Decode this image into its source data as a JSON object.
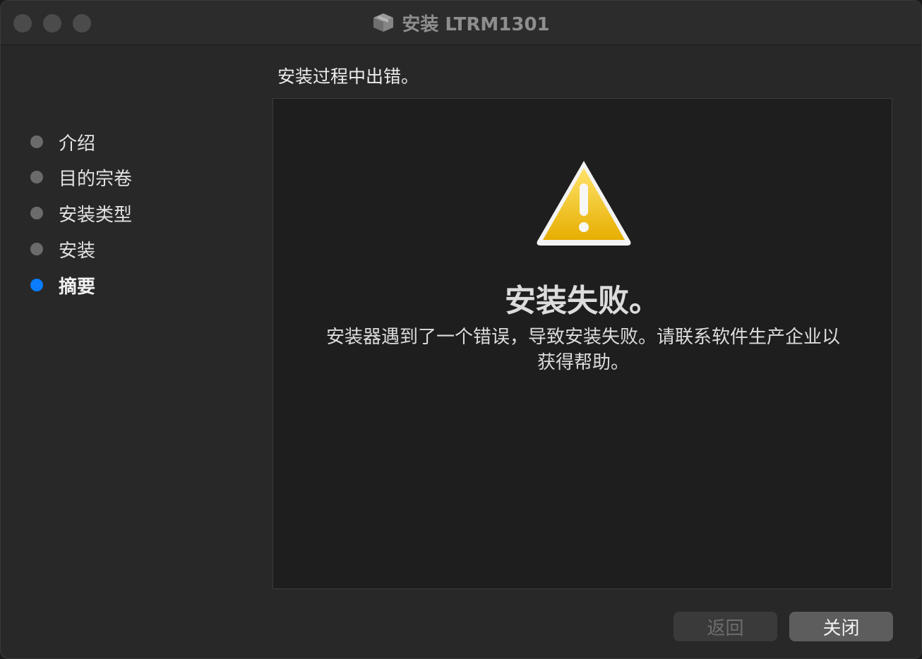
{
  "window": {
    "title": "安装 LTRM1301",
    "title_icon": "package-icon"
  },
  "sidebar": {
    "steps": [
      {
        "label": "介绍",
        "active": false
      },
      {
        "label": "目的宗卷",
        "active": false
      },
      {
        "label": "安装类型",
        "active": false
      },
      {
        "label": "安装",
        "active": false
      },
      {
        "label": "摘要",
        "active": true
      }
    ]
  },
  "main": {
    "heading": "安装过程中出错。",
    "icon": "warning-icon",
    "fail_title": "安装失败。",
    "fail_message": "安装器遇到了一个错误，导致安装失败。请联系软件生产企业以获得帮助。"
  },
  "buttons": {
    "back_label": "返回",
    "close_label": "关闭"
  },
  "colors": {
    "active_step": "#0a7cff",
    "warning_yellow": "#f2c200"
  }
}
